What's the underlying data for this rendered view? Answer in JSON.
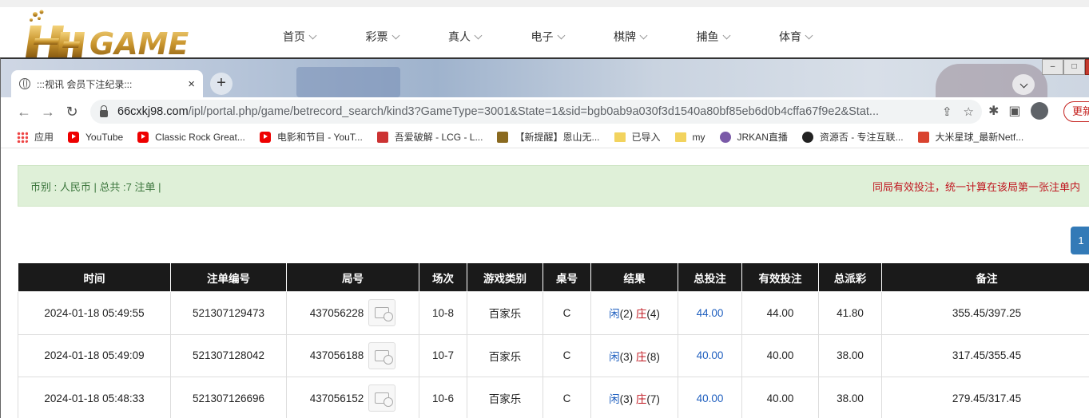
{
  "site": {
    "logo_text": "HH GAME",
    "nav": [
      "首页",
      "彩票",
      "真人",
      "电子",
      "棋牌",
      "捕鱼",
      "体育"
    ]
  },
  "browser": {
    "tab_title": ":::视讯 会员下注纪录:::",
    "tab_close": "×",
    "new_tab": "+",
    "url_host": "66cxkj98.com",
    "url_path": "/ipl/portal.php/game/betrecord_search/kind3?GameType=3001&State=1&sid=bgb0ab9a030f3d1540a80bf85eb6d0b4cffa67f9e2&Stat...",
    "update_label": "更新"
  },
  "bookmarks": [
    {
      "label": "应用",
      "icon": "apps-icon"
    },
    {
      "label": "YouTube",
      "icon": "youtube-icon"
    },
    {
      "label": "Classic Rock Great...",
      "icon": "youtube-icon"
    },
    {
      "label": "电影和节目 - YouT...",
      "icon": "youtube-icon"
    },
    {
      "label": "吾爱破解 - LCG - L...",
      "icon": "site-icon"
    },
    {
      "label": "【新提醒】恩山无...",
      "icon": "site-icon"
    },
    {
      "label": "已导入",
      "icon": "folder-icon"
    },
    {
      "label": "my",
      "icon": "folder-icon"
    },
    {
      "label": "JRKAN直播",
      "icon": "site-icon"
    },
    {
      "label": "资源否 - 专注互联...",
      "icon": "site-icon"
    },
    {
      "label": "大米星球_最新Netf...",
      "icon": "site-icon"
    }
  ],
  "summary": {
    "left": "币别 : 人民币 | 总共 :7 注单 |",
    "right": "同局有效投注，统一计算在该局第一张注单内"
  },
  "pager": {
    "current": "1"
  },
  "table": {
    "headers": [
      "时间",
      "注单编号",
      "局号",
      "场次",
      "游戏类别",
      "桌号",
      "结果",
      "总投注",
      "有效投注",
      "总派彩",
      "备注"
    ],
    "rows": [
      {
        "time": "2024-01-18 05:49:55",
        "bet_id": "521307129473",
        "round": "437056228",
        "session": "10-8",
        "game": "百家乐",
        "table": "C",
        "player": "闲",
        "player_pts": "(2)",
        "banker": "庄",
        "banker_pts": "(4)",
        "total_bet": "44.00",
        "valid_bet": "44.00",
        "payout": "41.80",
        "note": "355.45/397.25"
      },
      {
        "time": "2024-01-18 05:49:09",
        "bet_id": "521307128042",
        "round": "437056188",
        "session": "10-7",
        "game": "百家乐",
        "table": "C",
        "player": "闲",
        "player_pts": "(3)",
        "banker": "庄",
        "banker_pts": "(8)",
        "total_bet": "40.00",
        "valid_bet": "40.00",
        "payout": "38.00",
        "note": "317.45/355.45"
      },
      {
        "time": "2024-01-18 05:48:33",
        "bet_id": "521307126696",
        "round": "437056152",
        "session": "10-6",
        "game": "百家乐",
        "table": "C",
        "player": "闲",
        "player_pts": "(3)",
        "banker": "庄",
        "banker_pts": "(7)",
        "total_bet": "40.00",
        "valid_bet": "40.00",
        "payout": "38.00",
        "note": "279.45/317.45"
      }
    ]
  }
}
